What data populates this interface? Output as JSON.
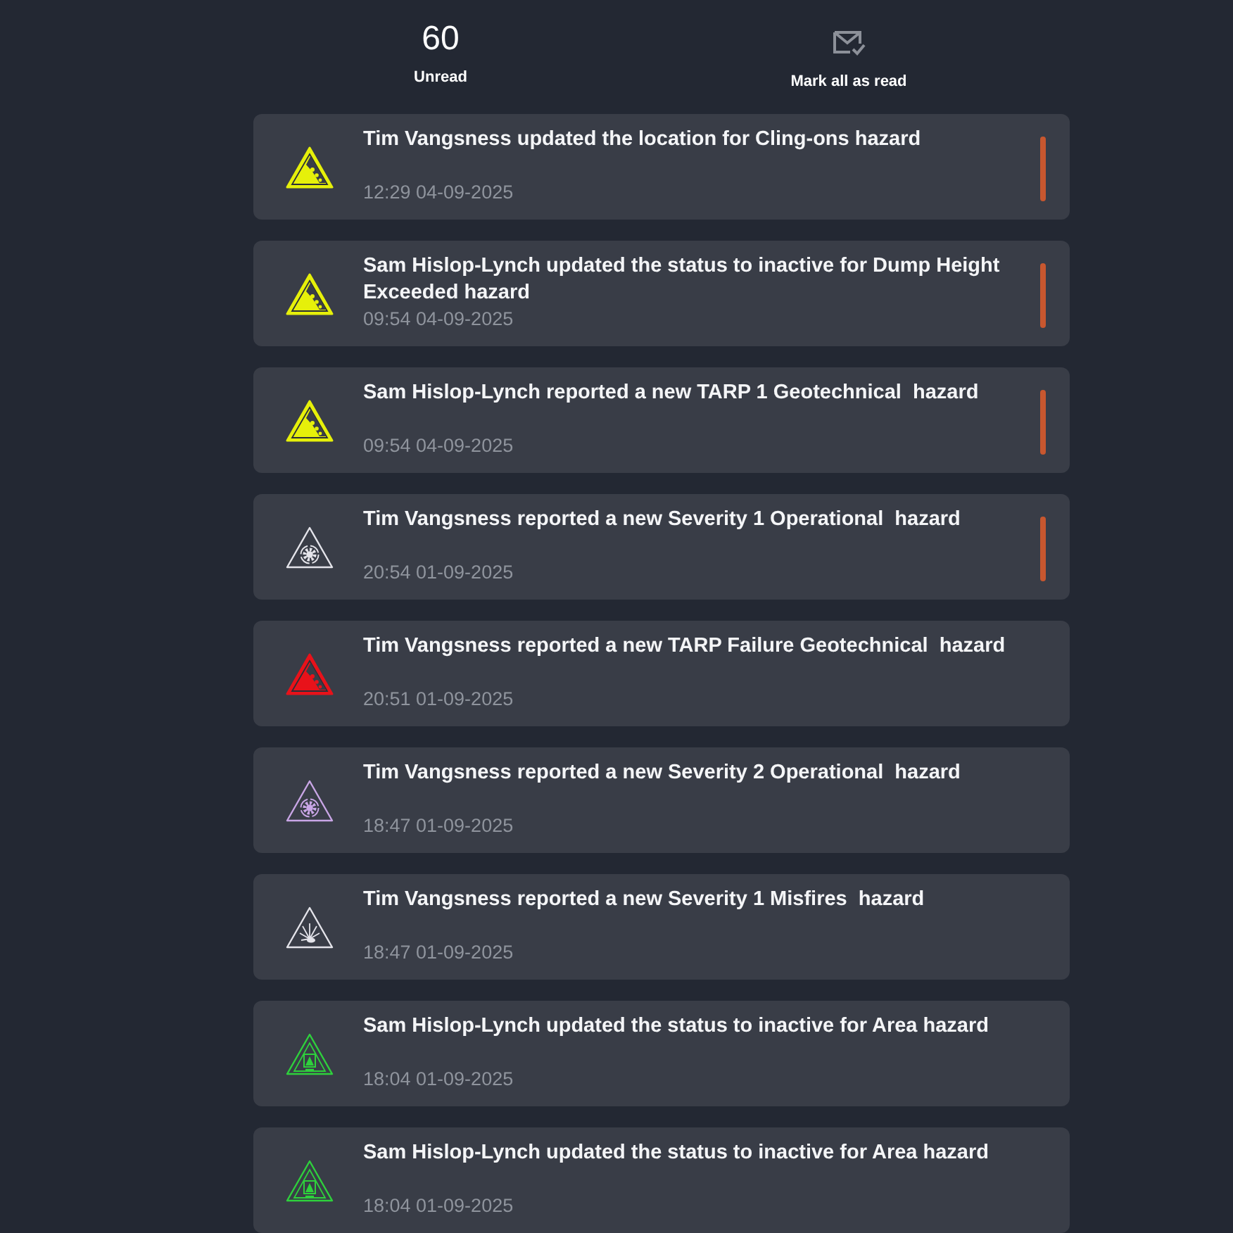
{
  "header": {
    "unread_count": "60",
    "unread_label": "Unread",
    "mark_all_button": "Mark all as read"
  },
  "notifications": [
    {
      "kind": "rockfall",
      "color": "#e6f00a",
      "message": "Tim Vangsness updated the location for Cling-ons hazard",
      "time": "12:29 04-09-2025",
      "unread": true
    },
    {
      "kind": "rockfall",
      "color": "#e6f00a",
      "message": "Sam Hislop-Lynch updated the status to inactive for Dump Height Exceeded hazard",
      "time": "09:54 04-09-2025",
      "unread": true
    },
    {
      "kind": "rockfall",
      "color": "#e6f00a",
      "message": "Sam Hislop-Lynch reported a new TARP 1 Geotechnical  hazard",
      "time": "09:54 04-09-2025",
      "unread": true
    },
    {
      "kind": "gear",
      "color": "#e4e4ea",
      "message": "Tim Vangsness reported a new Severity 1 Operational  hazard",
      "time": "20:54 01-09-2025",
      "unread": true
    },
    {
      "kind": "rockfall",
      "color": "#e8121a",
      "message": "Tim Vangsness reported a new TARP Failure Geotechnical  hazard",
      "time": "20:51 01-09-2025",
      "unread": false
    },
    {
      "kind": "gear",
      "color": "#c9a6e6",
      "message": "Tim Vangsness reported a new Severity 2 Operational  hazard",
      "time": "18:47 01-09-2025",
      "unread": false
    },
    {
      "kind": "misfire",
      "color": "#e4e4ea",
      "message": "Tim Vangsness reported a new Severity 1 Misfires  hazard",
      "time": "18:47 01-09-2025",
      "unread": false
    },
    {
      "kind": "area",
      "color": "#2ed13c",
      "message": "Sam Hislop-Lynch updated the status to inactive for Area hazard",
      "time": "18:04 01-09-2025",
      "unread": false
    },
    {
      "kind": "area",
      "color": "#2ed13c",
      "message": "Sam Hislop-Lynch updated the status to inactive for Area hazard",
      "time": "18:04 01-09-2025",
      "unread": false
    }
  ]
}
